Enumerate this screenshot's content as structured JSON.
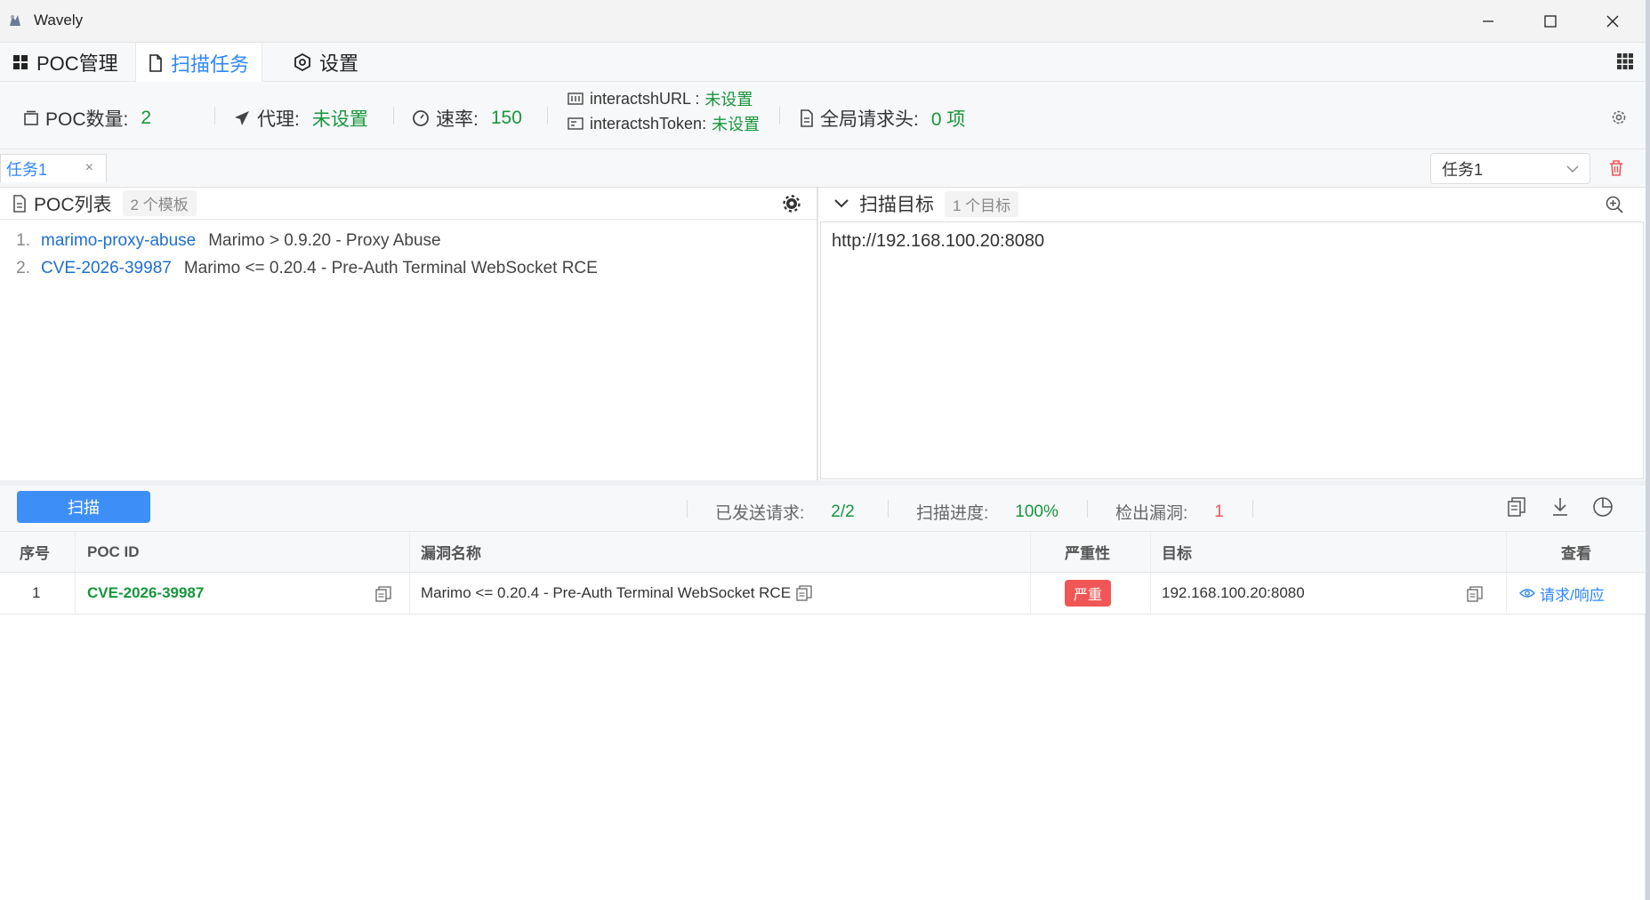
{
  "window": {
    "title": "Wavely"
  },
  "main_tabs": [
    {
      "label": "POC管理",
      "icon": "grid-icon"
    },
    {
      "label": "扫描任务",
      "icon": "file-icon"
    },
    {
      "label": "设置",
      "icon": "settings-hexagon-icon"
    }
  ],
  "status": {
    "poc_count_label": "POC数量:",
    "poc_count_value": "2",
    "proxy_label": "代理:",
    "proxy_value": "未设置",
    "rate_label": "速率:",
    "rate_value": "150",
    "interactsh_url_label": "interactshURL :",
    "interactsh_url_value": "未设置",
    "interactsh_token_label": "interactshToken:",
    "interactsh_token_value": "未设置",
    "headers_label": "全局请求头:",
    "headers_value": "0 项"
  },
  "task_tabs": [
    {
      "label": "任务1",
      "close": "×"
    }
  ],
  "task_select": {
    "value": "任务1"
  },
  "poc_panel": {
    "title": "POC列表",
    "badge": "2 个模板",
    "items": [
      {
        "num": "1.",
        "id": "marimo-proxy-abuse",
        "name": "Marimo > 0.9.20 - Proxy Abuse"
      },
      {
        "num": "2.",
        "id": "CVE-2026-39987",
        "name": "Marimo <= 0.20.4 - Pre-Auth Terminal WebSocket RCE"
      }
    ]
  },
  "target_panel": {
    "title": "扫描目标",
    "badge": "1 个目标",
    "value": "http://192.168.100.20:8080"
  },
  "scan": {
    "button_label": "扫描",
    "sent_label": "已发送请求:",
    "sent_value": "2/2",
    "progress_label": "扫描进度:",
    "progress_value": "100%",
    "vulns_label": "检出漏洞:",
    "vulns_value": "1"
  },
  "colors": {
    "accent": "#2f87ff",
    "success": "#17963b",
    "danger": "#f05656"
  },
  "results_table": {
    "columns": [
      "序号",
      "POC ID",
      "漏洞名称",
      "严重性",
      "目标",
      "查看"
    ],
    "rows": [
      {
        "index": "1",
        "poc_id": "CVE-2026-39987",
        "name": "Marimo <= 0.20.4 - Pre-Auth Terminal WebSocket RCE",
        "severity": "严重",
        "target": "192.168.100.20:8080",
        "view": "请求/响应"
      }
    ]
  }
}
